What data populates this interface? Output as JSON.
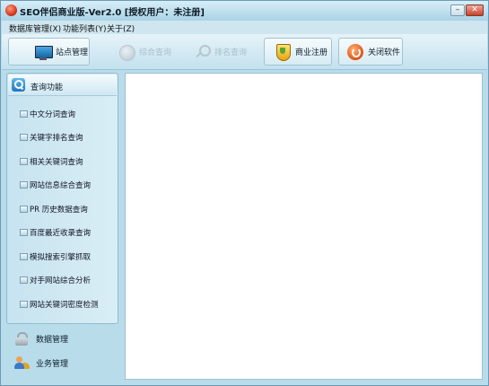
{
  "window": {
    "title": "SEO伴侣商业版-Ver2.0 [授权用户：未注册]",
    "minimize_glyph": "–",
    "close_glyph": "✕"
  },
  "menu": [
    {
      "label": "数据库管理(X)"
    },
    {
      "label": "功能列表(Y)"
    },
    {
      "label": "关于(Z)"
    }
  ],
  "toolbar": [
    {
      "label": "站点管理",
      "icon": "monitor-icon",
      "enabled": true
    },
    {
      "label": "综合查询",
      "icon": "globe-icon",
      "enabled": false
    },
    {
      "label": "排名查询",
      "icon": "magnifier-icon",
      "enabled": false
    },
    {
      "label": "商业注册",
      "icon": "shield-icon",
      "enabled": true
    },
    {
      "label": "关闭软件",
      "icon": "power-icon",
      "enabled": true
    }
  ],
  "sidebar": {
    "header": "查询功能",
    "items": [
      {
        "label": "中文分词查询"
      },
      {
        "label": "关键字排名查询"
      },
      {
        "label": "相关关键词查询"
      },
      {
        "label": "网站信息综合查询"
      },
      {
        "label": "PR 历史数据查询"
      },
      {
        "label": "百度最近收录查询"
      },
      {
        "label": "模拟搜索引擎抓取"
      },
      {
        "label": "对手网站综合分析"
      },
      {
        "label": "网站关键词密度检测"
      }
    ],
    "bottom": [
      {
        "label": "数据管理",
        "icon": "lock-icon"
      },
      {
        "label": "业务管理",
        "icon": "users-icon"
      }
    ]
  },
  "colors": {
    "window_bg": "#b9dcea",
    "titlebar": "#a9d3e6",
    "content_bg": "#ffffff"
  }
}
